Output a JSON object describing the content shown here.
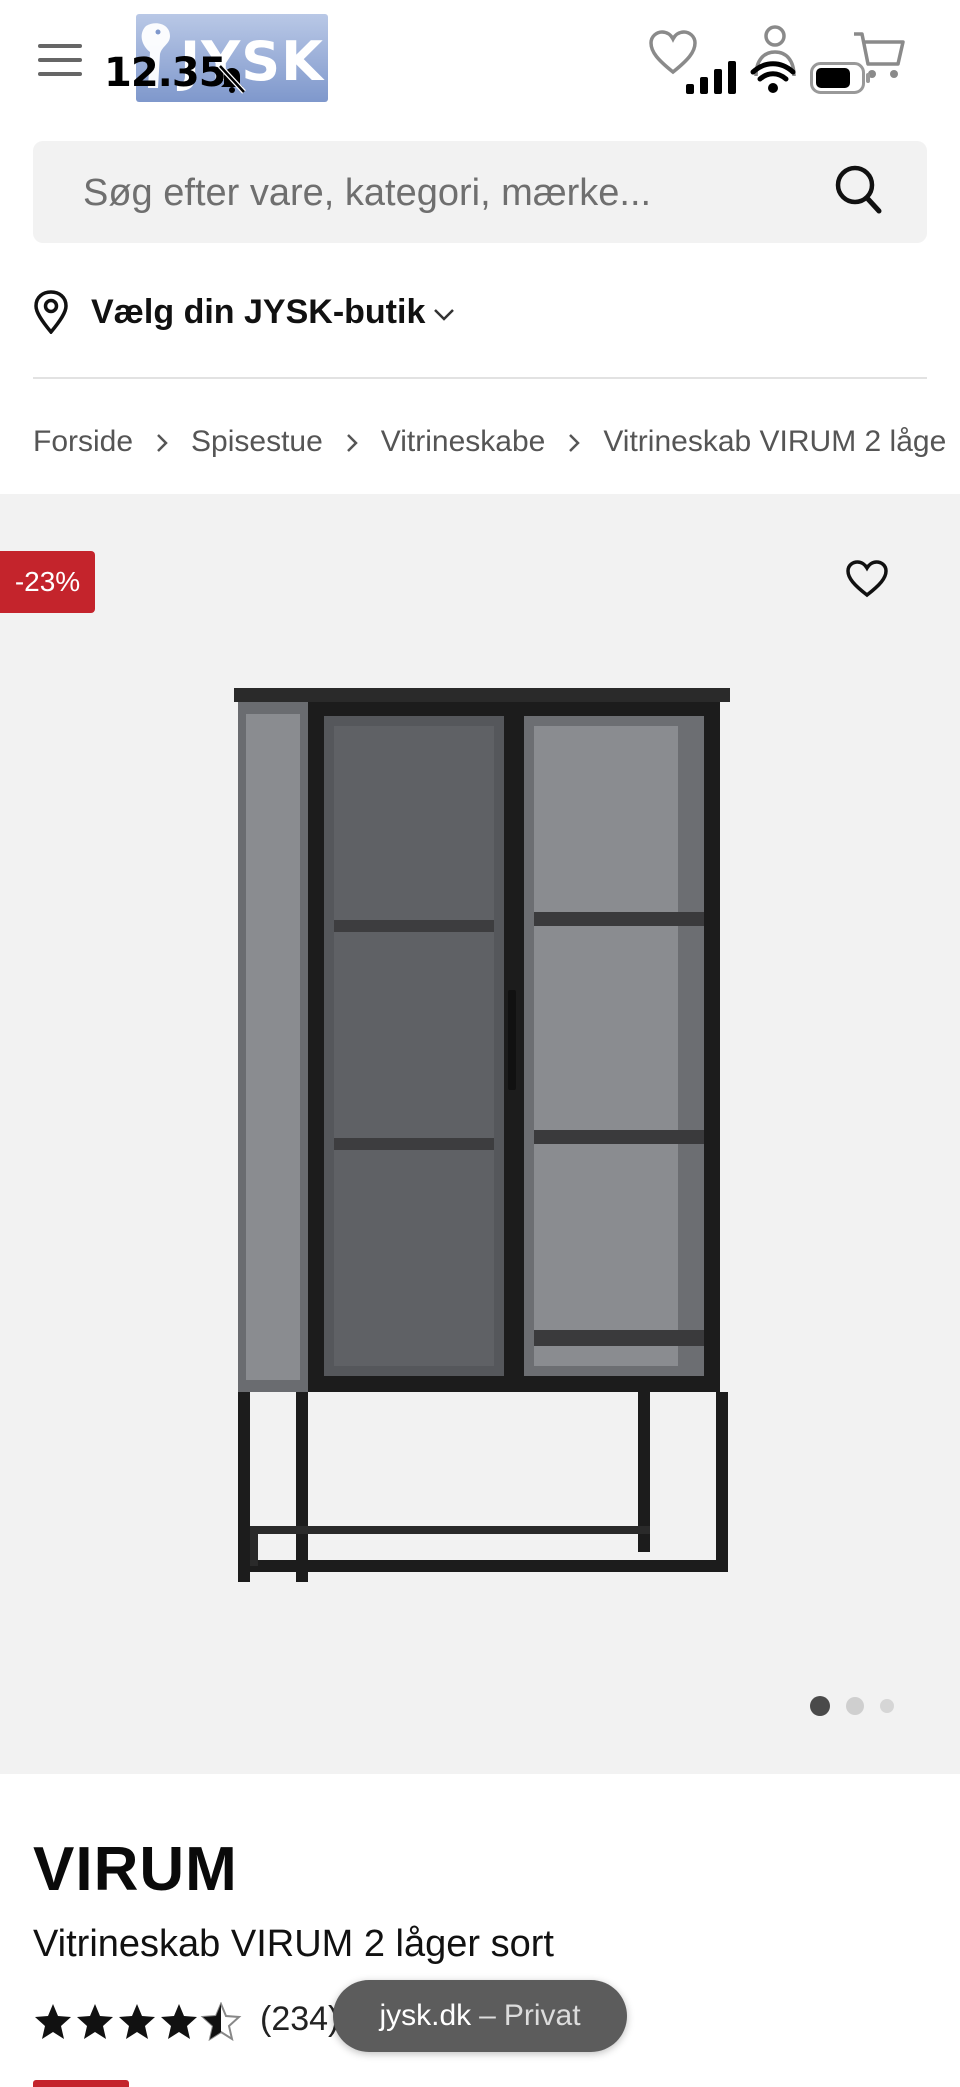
{
  "status_bar": {
    "time": "12.35"
  },
  "header": {
    "logo_text": "JYSK",
    "icons": [
      "menu-icon",
      "heart-icon",
      "user-icon",
      "cart-icon"
    ]
  },
  "search": {
    "placeholder": "Søg efter vare, kategori, mærke..."
  },
  "store_picker": {
    "label": "Vælg din JYSK-butik"
  },
  "breadcrumb": [
    "Forside",
    "Spisestue",
    "Vitrineskabe",
    "Vitrineskab VIRUM 2 låge"
  ],
  "gallery": {
    "discount_badge": "-23%",
    "image_count": 3,
    "active_index": 0
  },
  "product": {
    "brand": "VIRUM",
    "name": "Vitrineskab VIRUM 2 låger sort",
    "rating": 4.5,
    "review_count": "(234)"
  },
  "browser": {
    "domain": "jysk.dk",
    "separator": "–",
    "mode": "Privat"
  },
  "colors": {
    "accent_red": "#c4242c",
    "gallery_bg": "#f2f2f2",
    "search_bg": "#f2f2f2"
  }
}
